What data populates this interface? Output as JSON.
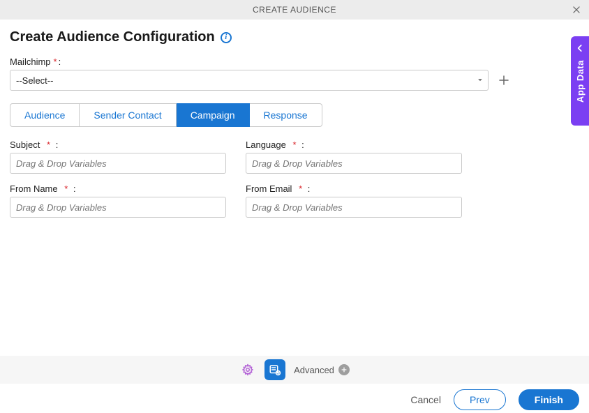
{
  "header": {
    "title": "CREATE AUDIENCE"
  },
  "sideTab": {
    "label": "App Data"
  },
  "pageTitle": "Create Audience Configuration",
  "mailchimp": {
    "label": "Mailchimp",
    "requiredMark": "*",
    "colon": ":",
    "selectedText": "--Select--"
  },
  "tabs": [
    {
      "label": "Audience",
      "active": false
    },
    {
      "label": "Sender Contact",
      "active": false
    },
    {
      "label": "Campaign",
      "active": true
    },
    {
      "label": "Response",
      "active": false
    }
  ],
  "fields": {
    "subject": {
      "label": "Subject",
      "placeholder": "Drag & Drop Variables"
    },
    "language": {
      "label": "Language",
      "placeholder": "Drag & Drop Variables"
    },
    "fromName": {
      "label": "From Name",
      "placeholder": "Drag & Drop Variables"
    },
    "fromEmail": {
      "label": "From Email",
      "placeholder": "Drag & Drop Variables"
    }
  },
  "advanced": {
    "label": "Advanced"
  },
  "buttons": {
    "cancel": "Cancel",
    "prev": "Prev",
    "finish": "Finish"
  },
  "marks": {
    "required": "*",
    "colon": ":"
  }
}
